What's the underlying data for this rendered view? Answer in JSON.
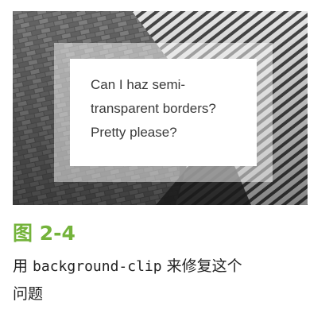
{
  "figure": {
    "demo_lines": [
      "Can I haz semi-",
      "transparent borders?",
      "Pretty please?"
    ],
    "background_image": "grayscale-stone-wall-and-striped-stairs-photo"
  },
  "caption": {
    "label": "图 2-4",
    "prefix": "用 ",
    "code": "background-clip",
    "suffix": " 来修复这个",
    "second_line": "问题"
  },
  "colors": {
    "caption_label": "#74b33b",
    "text": "#222222",
    "demo_text": "#3a3a3a"
  }
}
